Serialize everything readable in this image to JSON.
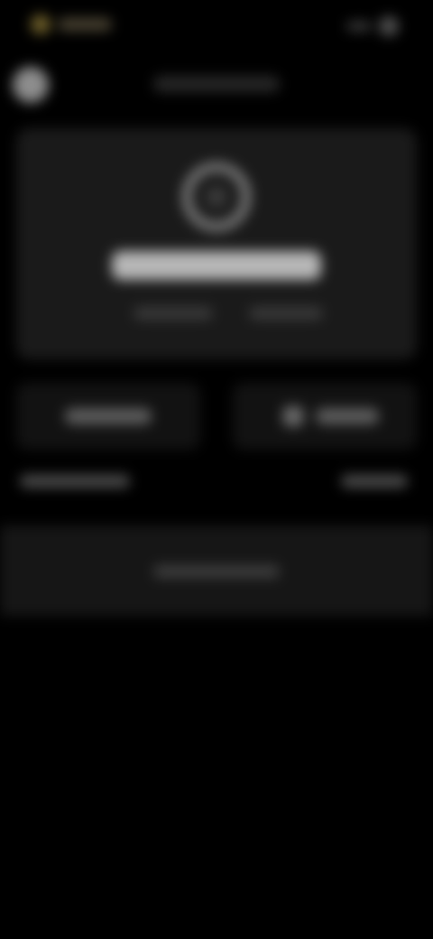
{
  "theme": {
    "background": "#000000",
    "card": "#1a1a1a",
    "accent_status": "#6e5f2a"
  },
  "icons": {
    "back": "chevron-left-icon",
    "avatar": "avatar-icon",
    "action_right": "square-icon",
    "status_left": "dot-icon",
    "status_right": "battery-icon"
  }
}
